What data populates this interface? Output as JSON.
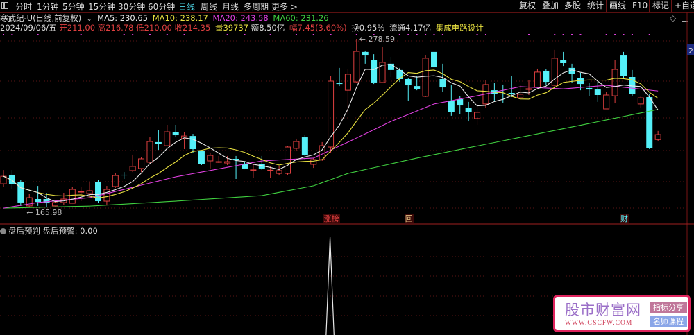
{
  "toolbar": {
    "periods": [
      "分时",
      "1分钟",
      "5分钟",
      "15分钟",
      "30分钟",
      "60分钟",
      "日线",
      "周线",
      "月线",
      "多周期",
      "更多 >"
    ],
    "active_period": "日线",
    "right_buttons": [
      "复权",
      "叠加",
      "多股",
      "统计",
      "画线",
      "F10",
      "标记",
      "+自选"
    ]
  },
  "header": {
    "title": "寒武纪-U(日线,前复权)",
    "ma5": "MA5: 230.65",
    "ma10": "MA10: 238.17",
    "ma20": "MA20: 243.58",
    "ma60": "MA60: 231.26",
    "date": "2024/09/06/五",
    "open": "开211.00",
    "high": "高216.78",
    "low": "低210.00",
    "close": "收214.35",
    "volume": "量39737",
    "amount": "额8.50亿",
    "change": "幅7.45(3.60%)",
    "turnover": "换0.95%",
    "float": "流通4.17亿",
    "sector": "集成电路设计"
  },
  "colors": {
    "up": "#e04040",
    "down": "#54f0f8",
    "ma5": "#e8e8e8",
    "ma10": "#e8e040",
    "ma20": "#e040e0",
    "ma60": "#40d040"
  },
  "main_chart": {
    "high_label": "278.59",
    "low_label": "165.98",
    "axis_tag": "2",
    "candles": [
      [
        181.3,
        190.6,
        179.0,
        186.4
      ],
      [
        187.4,
        190.6,
        178.1,
        180.9
      ],
      [
        182.3,
        183.7,
        166.5,
        168.8
      ],
      [
        166.5,
        174.4,
        165.98,
        172.0
      ],
      [
        171.1,
        179.9,
        166.5,
        169.2
      ],
      [
        171.1,
        175.3,
        166.0,
        168.3
      ],
      [
        166.5,
        170.2,
        166.2,
        168.8
      ],
      [
        168.8,
        175.3,
        167.4,
        171.1
      ],
      [
        168.3,
        179.0,
        168.3,
        177.6
      ],
      [
        175.8,
        179.0,
        169.7,
        176.2
      ],
      [
        174.8,
        182.3,
        172.0,
        176.7
      ],
      [
        182.3,
        183.7,
        168.3,
        169.7
      ],
      [
        169.7,
        179.9,
        167.4,
        177.6
      ],
      [
        179.5,
        188.3,
        178.6,
        186.9
      ],
      [
        187.4,
        189.2,
        184.6,
        186.9
      ],
      [
        190.2,
        200.9,
        189.2,
        193.0
      ],
      [
        191.6,
        199.0,
        189.2,
        198.1
      ],
      [
        195.8,
        212.5,
        195.3,
        209.7
      ],
      [
        209.3,
        217.2,
        204.1,
        207.9
      ],
      [
        206.9,
        220.9,
        206.9,
        216.2
      ],
      [
        216.2,
        220.9,
        212.5,
        213.9
      ],
      [
        211.6,
        216.2,
        204.6,
        213.4
      ],
      [
        213.4,
        214.8,
        202.3,
        204.6
      ],
      [
        203.2,
        203.2,
        193.9,
        194.8
      ],
      [
        196.7,
        202.3,
        191.6,
        200.4
      ],
      [
        195.8,
        200.0,
        195.3,
        196.2
      ],
      [
        195.3,
        200.0,
        193.9,
        196.2
      ],
      [
        198.1,
        200.0,
        184.6,
        197.2
      ],
      [
        194.4,
        196.2,
        191.1,
        191.6
      ],
      [
        190.2,
        194.4,
        185.1,
        190.7
      ],
      [
        194.4,
        200.0,
        190.7,
        191.6
      ],
      [
        190.2,
        193.0,
        185.1,
        190.5
      ],
      [
        188.3,
        193.0,
        186.9,
        190.2
      ],
      [
        188.3,
        206.9,
        187.4,
        206.0
      ],
      [
        205.1,
        211.6,
        203.2,
        209.7
      ],
      [
        212.5,
        213.9,
        197.6,
        200.4
      ],
      [
        194.4,
        198.5,
        192.0,
        197.6
      ],
      [
        197.6,
        209.3,
        196.7,
        206.9
      ],
      [
        206.0,
        253.5,
        202.3,
        250.2
      ],
      [
        248.8,
        259.1,
        246.9,
        248.3
      ],
      [
        244.1,
        258.6,
        227.9,
        254.9
      ],
      [
        249.7,
        278.59,
        248.8,
        270.2
      ],
      [
        269.8,
        270.7,
        261.9,
        267.4
      ],
      [
        264.6,
        268.3,
        248.3,
        249.3
      ],
      [
        249.3,
        273.0,
        249.3,
        262.8
      ],
      [
        261.9,
        266.5,
        253.0,
        257.7
      ],
      [
        257.7,
        259.1,
        249.7,
        251.6
      ],
      [
        251.6,
        252.5,
        237.2,
        247.4
      ],
      [
        246.9,
        253.5,
        244.1,
        245.1
      ],
      [
        240.0,
        267.4,
        239.5,
        265.6
      ],
      [
        269.8,
        274.4,
        258.1,
        259.5
      ],
      [
        251.6,
        261.9,
        242.8,
        246.0
      ],
      [
        237.2,
        247.4,
        227.0,
        229.3
      ],
      [
        238.1,
        240.0,
        227.9,
        233.9
      ],
      [
        232.5,
        236.3,
        223.2,
        229.7
      ],
      [
        225.1,
        234.9,
        220.9,
        229.3
      ],
      [
        234.9,
        251.1,
        232.5,
        247.9
      ],
      [
        244.1,
        248.8,
        237.2,
        241.8
      ],
      [
        241.8,
        247.9,
        235.8,
        241.4
      ],
      [
        242.3,
        253.5,
        239.5,
        241.8
      ],
      [
        239.0,
        247.9,
        238.1,
        241.4
      ],
      [
        244.6,
        251.1,
        240.9,
        245.1
      ],
      [
        246.0,
        258.6,
        245.6,
        256.3
      ],
      [
        257.2,
        258.1,
        247.9,
        249.7
      ],
      [
        247.4,
        271.2,
        246.5,
        265.6
      ],
      [
        264.2,
        269.8,
        260.4,
        262.3
      ],
      [
        259.1,
        261.9,
        248.8,
        254.9
      ],
      [
        252.5,
        255.8,
        244.1,
        248.3
      ],
      [
        245.6,
        248.8,
        240.0,
        244.6
      ],
      [
        244.6,
        249.7,
        236.3,
        240.9
      ],
      [
        231.6,
        242.8,
        231.6,
        240.9
      ],
      [
        240.4,
        264.2,
        235.3,
        258.1
      ],
      [
        267.4,
        269.8,
        252.5,
        253.5
      ],
      [
        253.0,
        257.7,
        240.4,
        241.4
      ],
      [
        234.9,
        240.4,
        232.5,
        239.0
      ],
      [
        239.5,
        241.4,
        204.6,
        205.5
      ],
      [
        211.0,
        216.78,
        210.0,
        214.35
      ]
    ],
    "ma20_points": [
      [
        0,
        165
      ],
      [
        4,
        168.8
      ],
      [
        10,
        172
      ],
      [
        20,
        186
      ],
      [
        30,
        196.7
      ],
      [
        36,
        198.6
      ],
      [
        40,
        209.3
      ],
      [
        45,
        223.2
      ],
      [
        50,
        234.9
      ],
      [
        55,
        240.4
      ],
      [
        60,
        246.5
      ],
      [
        65,
        245
      ],
      [
        70,
        247.4
      ],
      [
        76,
        243.58
      ]
    ],
    "ma60_points": [
      [
        0,
        165
      ],
      [
        10,
        166.4
      ],
      [
        20,
        169.7
      ],
      [
        30,
        173.4
      ],
      [
        36,
        180
      ],
      [
        40,
        188.3
      ],
      [
        48,
        198.6
      ],
      [
        60,
        212.5
      ],
      [
        68,
        221.8
      ],
      [
        76,
        231.26
      ]
    ],
    "event_marker_days": [
      0,
      1,
      4,
      9,
      14,
      15,
      17,
      19,
      21,
      26,
      28,
      31,
      34,
      36,
      38,
      41,
      43,
      46,
      47,
      48,
      49,
      50,
      51,
      55,
      56,
      61,
      64,
      65,
      66,
      67,
      70,
      71,
      72,
      73,
      75
    ],
    "tags": [
      {
        "day": 38,
        "label": "涨榜",
        "color": "#e04040"
      },
      {
        "day": 47,
        "label": "回",
        "color": "#e0c080"
      },
      {
        "day": 72,
        "label": "财",
        "color": "#54f0f8"
      }
    ]
  },
  "sub_chart": {
    "name": "盘后预判",
    "value_label": "盘后预警: 0.00",
    "signal_days": [
      38
    ]
  },
  "watermark": {
    "title": "股市财富网",
    "url": "WWW.GSCFW.COM",
    "badge1": "指标分享",
    "badge2": "名师课程"
  }
}
